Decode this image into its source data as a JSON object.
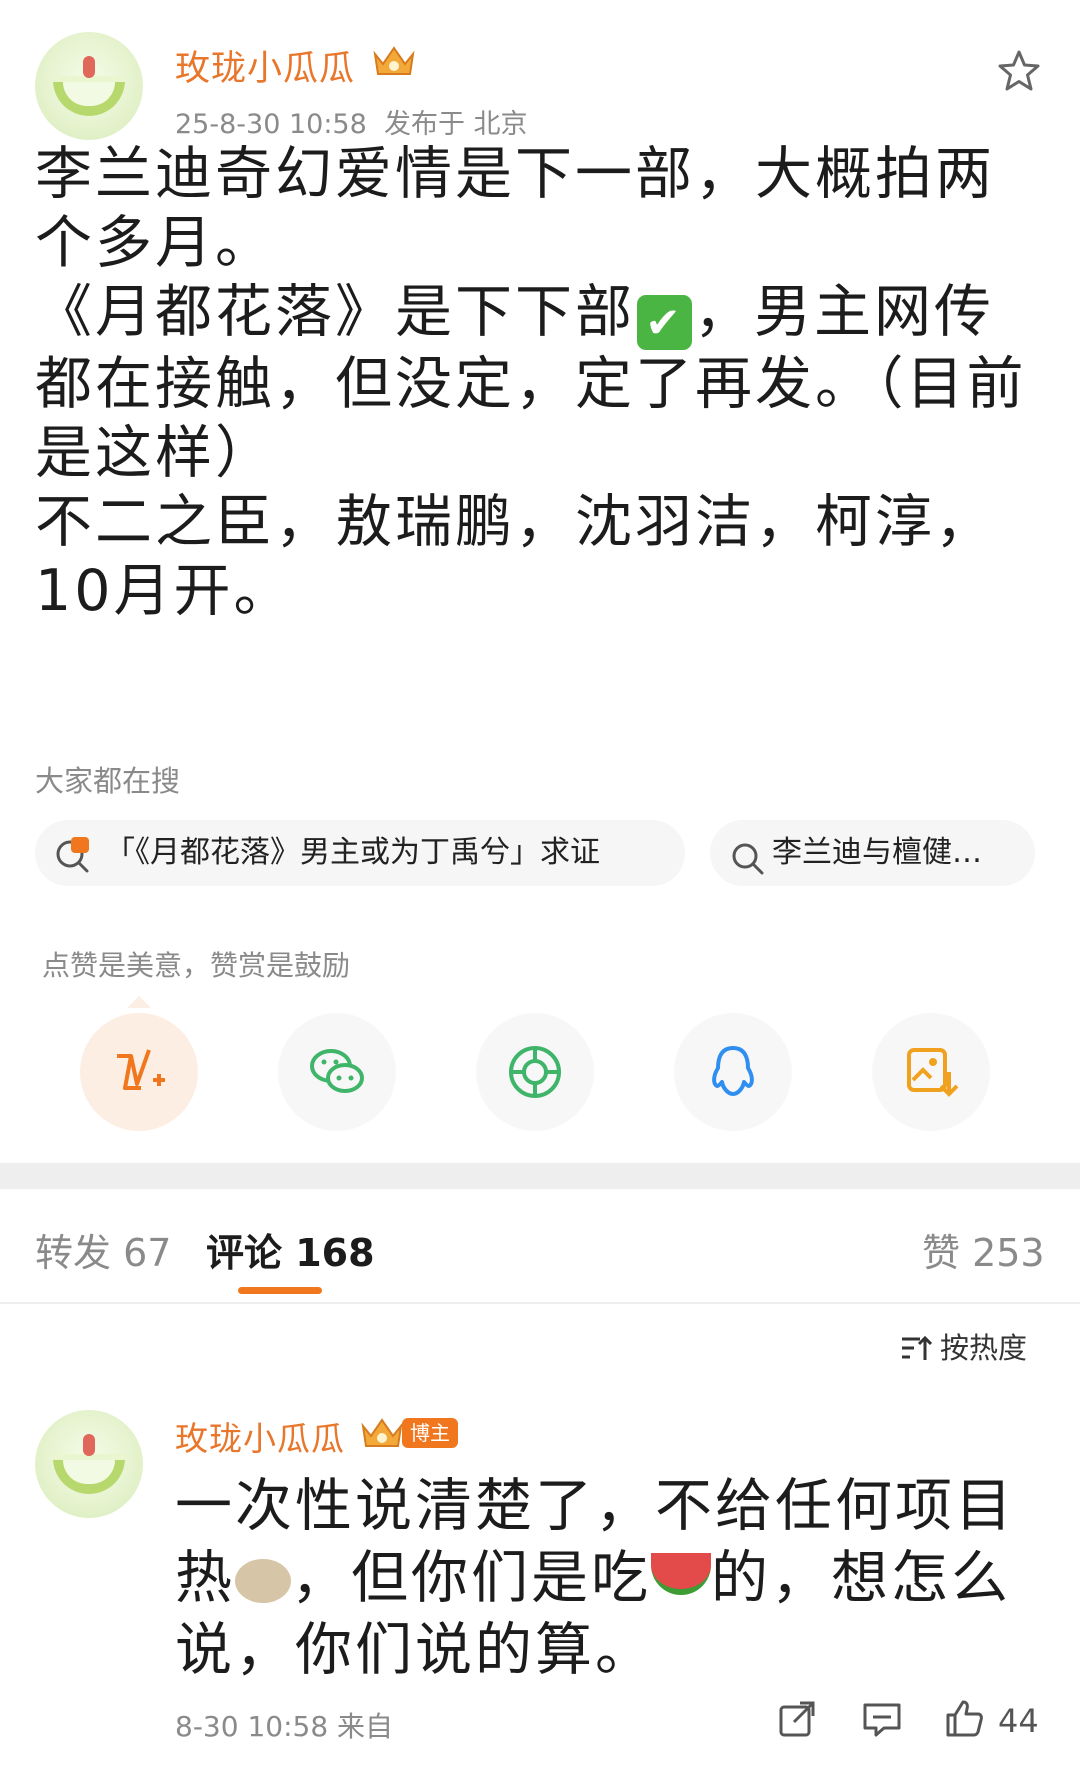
{
  "post": {
    "author": "玫珑小瓜瓜",
    "timestamp": "25-8-30 10:58",
    "location": "发布于 北京",
    "paragraphs": [
      "李兰迪奇幻爱情是下一部，大概拍两个多月。",
      "《月都花落》是下下部",
      "，男主网传都在接触，但没定，定了再发。（目前是这样）",
      "不二之臣，敖瑞鹏，沈羽洁，柯淳，10月开。"
    ],
    "check_emoji": "✔"
  },
  "hot_search": {
    "label": "大家都在搜",
    "items": [
      "「《月都花落》男主或为丁禹兮」求证",
      "李兰迪与檀健…"
    ]
  },
  "share": {
    "hint": "点赞是美意，赞赏是鼓励",
    "icons": [
      "vip-reward-icon",
      "wechat-icon",
      "moments-icon",
      "qq-icon",
      "save-image-icon"
    ]
  },
  "tabs": {
    "repost": "转发 67",
    "comments": "评论 168",
    "likes": "赞 253"
  },
  "sort_label": "按热度",
  "comment": {
    "author": "玫珑小瓜瓜",
    "badge": "博主",
    "text_1": "一次性说清楚了，不给任何项目热",
    "text_2": "，但你们是吃",
    "text_3": "的，想怎么说，你们说的算。",
    "time": "8-30 10:58 来自",
    "like_count": "44"
  },
  "colors": {
    "accent": "#f0771e",
    "username": "#e8762b",
    "meta": "#8a8a8a"
  }
}
